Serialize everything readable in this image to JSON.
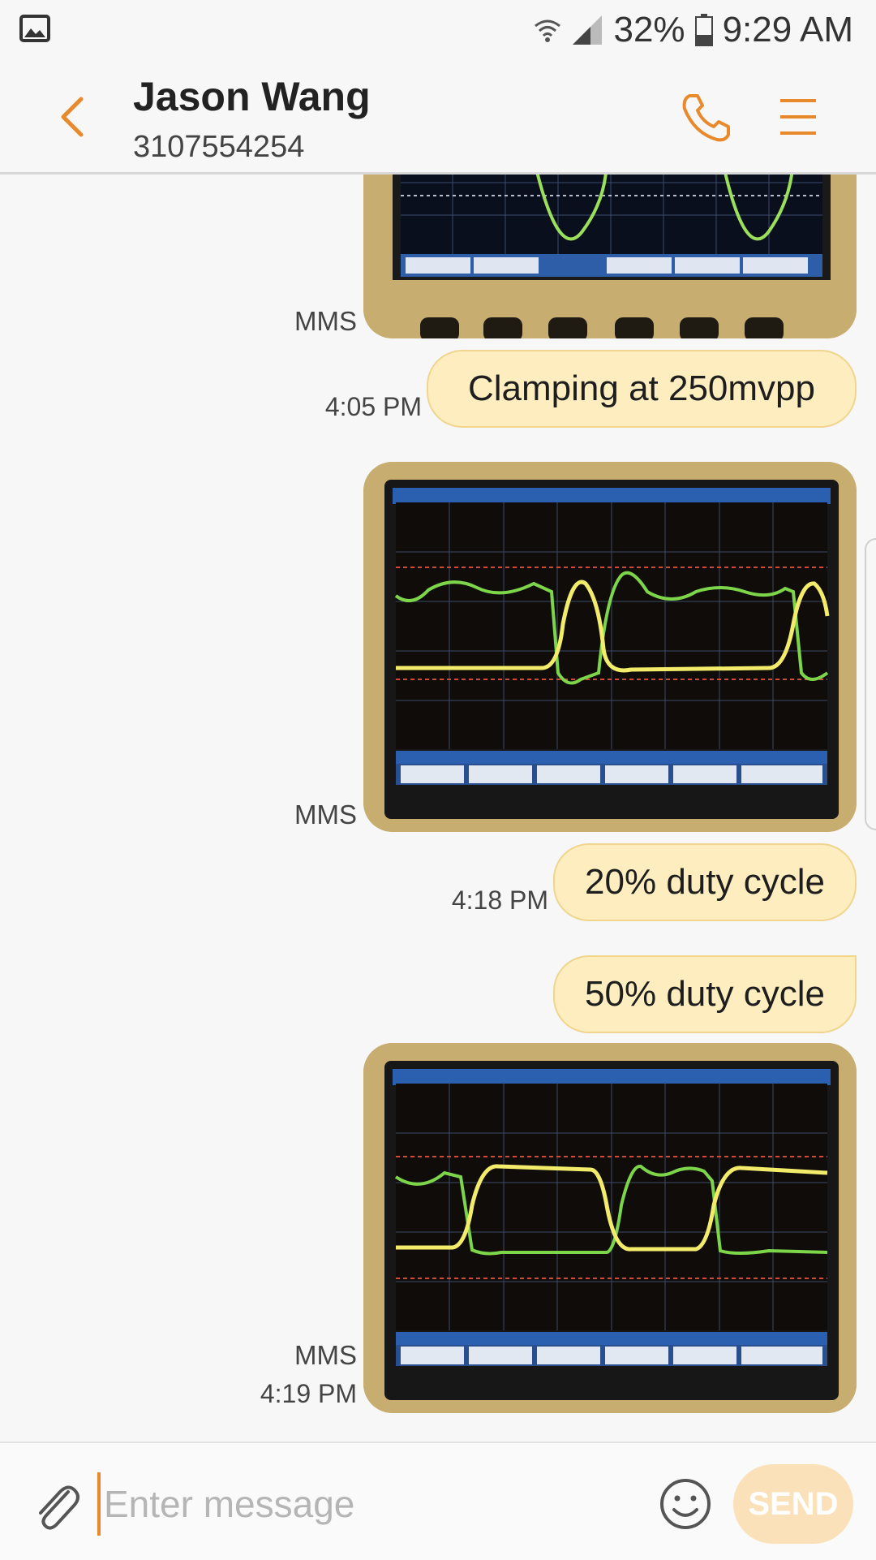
{
  "status_bar": {
    "battery": "32%",
    "time": "9:29 AM",
    "icons": [
      "gallery-icon",
      "wifi-icon",
      "signal-icon",
      "battery-icon"
    ]
  },
  "header": {
    "contact_name": "Jason Wang",
    "contact_number": "3107554254",
    "icons": [
      "back-arrow-icon",
      "phone-icon",
      "menu-icon"
    ]
  },
  "messages": [
    {
      "type": "mms",
      "label": "MMS"
    },
    {
      "type": "text",
      "text": "Clamping at 250mvpp",
      "time": "4:05 PM"
    },
    {
      "type": "mms",
      "label": "MMS"
    },
    {
      "type": "text",
      "text": "20% duty cycle",
      "time": "4:18 PM"
    },
    {
      "type": "text",
      "text": "50% duty cycle"
    },
    {
      "type": "mms",
      "label": "MMS",
      "time": "4:19 PM"
    }
  ],
  "composer": {
    "placeholder": "Enter message",
    "send_label": "SEND",
    "icons": [
      "paperclip-icon",
      "emoji-icon"
    ]
  },
  "colors": {
    "accent": "#e8892c",
    "bubble": "#fdedbf",
    "bubble_border": "#efd58d",
    "send_button": "#fbe1ba",
    "scope_bezel": "#c8ad70",
    "trace_green": "#7dd64a",
    "trace_yellow": "#f2ec6a"
  }
}
